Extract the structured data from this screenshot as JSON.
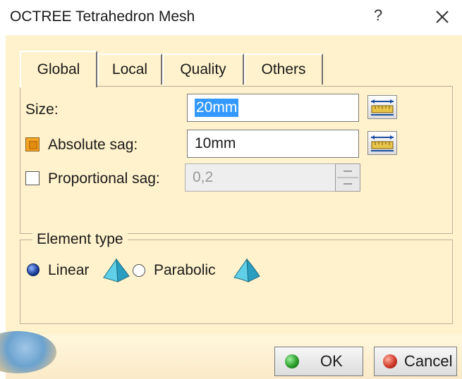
{
  "window": {
    "title": "OCTREE Tetrahedron Mesh",
    "help_label": "?",
    "close_icon": "close-icon"
  },
  "tabs": [
    {
      "label": "Global",
      "active": true
    },
    {
      "label": "Local",
      "active": false
    },
    {
      "label": "Quality",
      "active": false
    },
    {
      "label": "Others",
      "active": false
    }
  ],
  "global": {
    "size_label": "Size:",
    "size_value": "20mm",
    "absolute_sag_label": "Absolute sag:",
    "absolute_sag_checked": true,
    "absolute_sag_value": "10mm",
    "proportional_sag_label": "Proportional sag:",
    "proportional_sag_checked": false,
    "proportional_sag_value": "0,2"
  },
  "element_type": {
    "title": "Element type",
    "linear_label": "Linear",
    "parabolic_label": "Parabolic",
    "selected": "Linear"
  },
  "buttons": {
    "ok_label": "OK",
    "cancel_label": "Cancel"
  },
  "colors": {
    "dialog_bg": "#fff2cc",
    "accent_blue": "#3399ff",
    "ok_green": "#2a9d2a",
    "cancel_red": "#d23a2a",
    "tetra_cyan": "#3fb8d8"
  }
}
